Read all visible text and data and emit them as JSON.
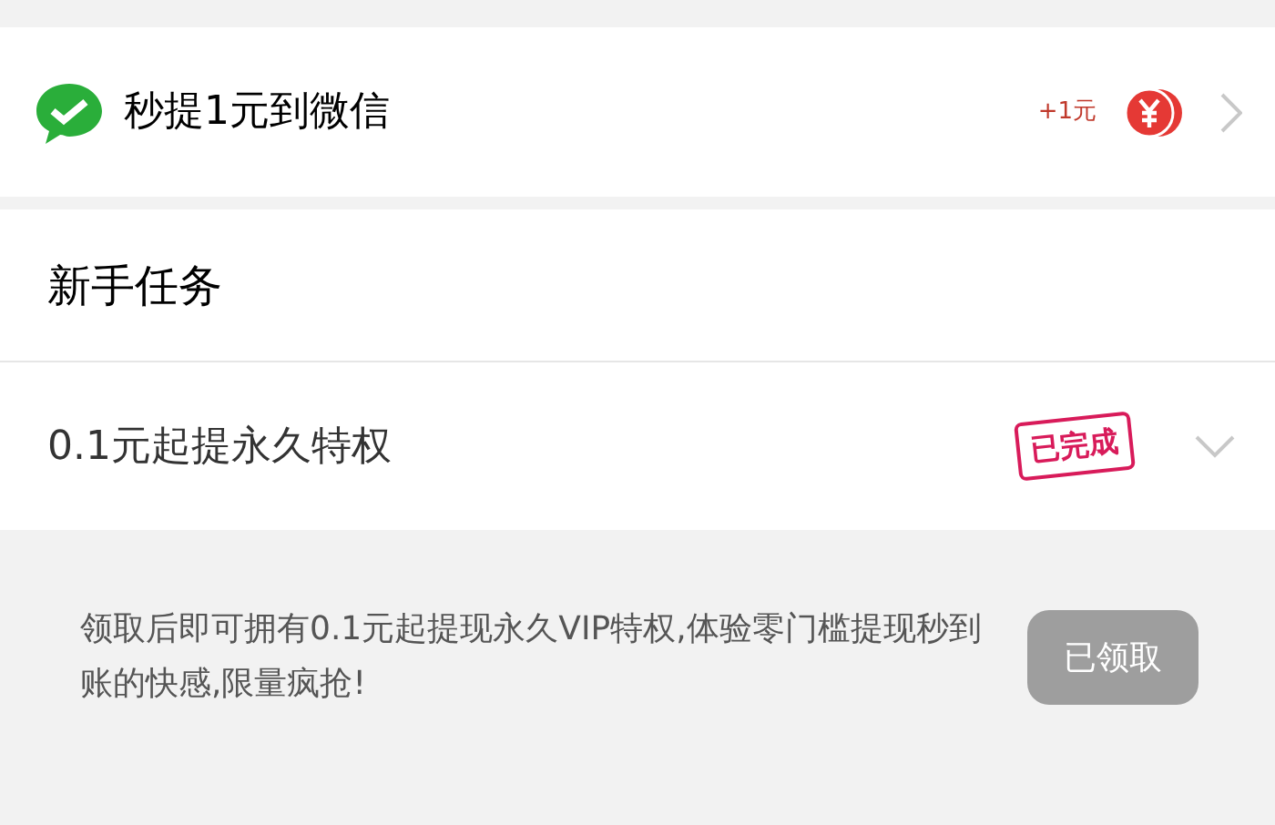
{
  "withdraw_row": {
    "title": "秒提1元到微信",
    "reward": "+1元"
  },
  "section": {
    "title": "新手任务"
  },
  "tasks": [
    {
      "title": "0.1元起提永久特权",
      "status": "已完成",
      "completed": true,
      "expanded": true,
      "description": "领取后即可拥有0.1元起提现永久VIP特权,体验零门槛提现秒到账的快感,限量疯抢!",
      "button": "已领取",
      "disabled": true
    }
  ]
}
